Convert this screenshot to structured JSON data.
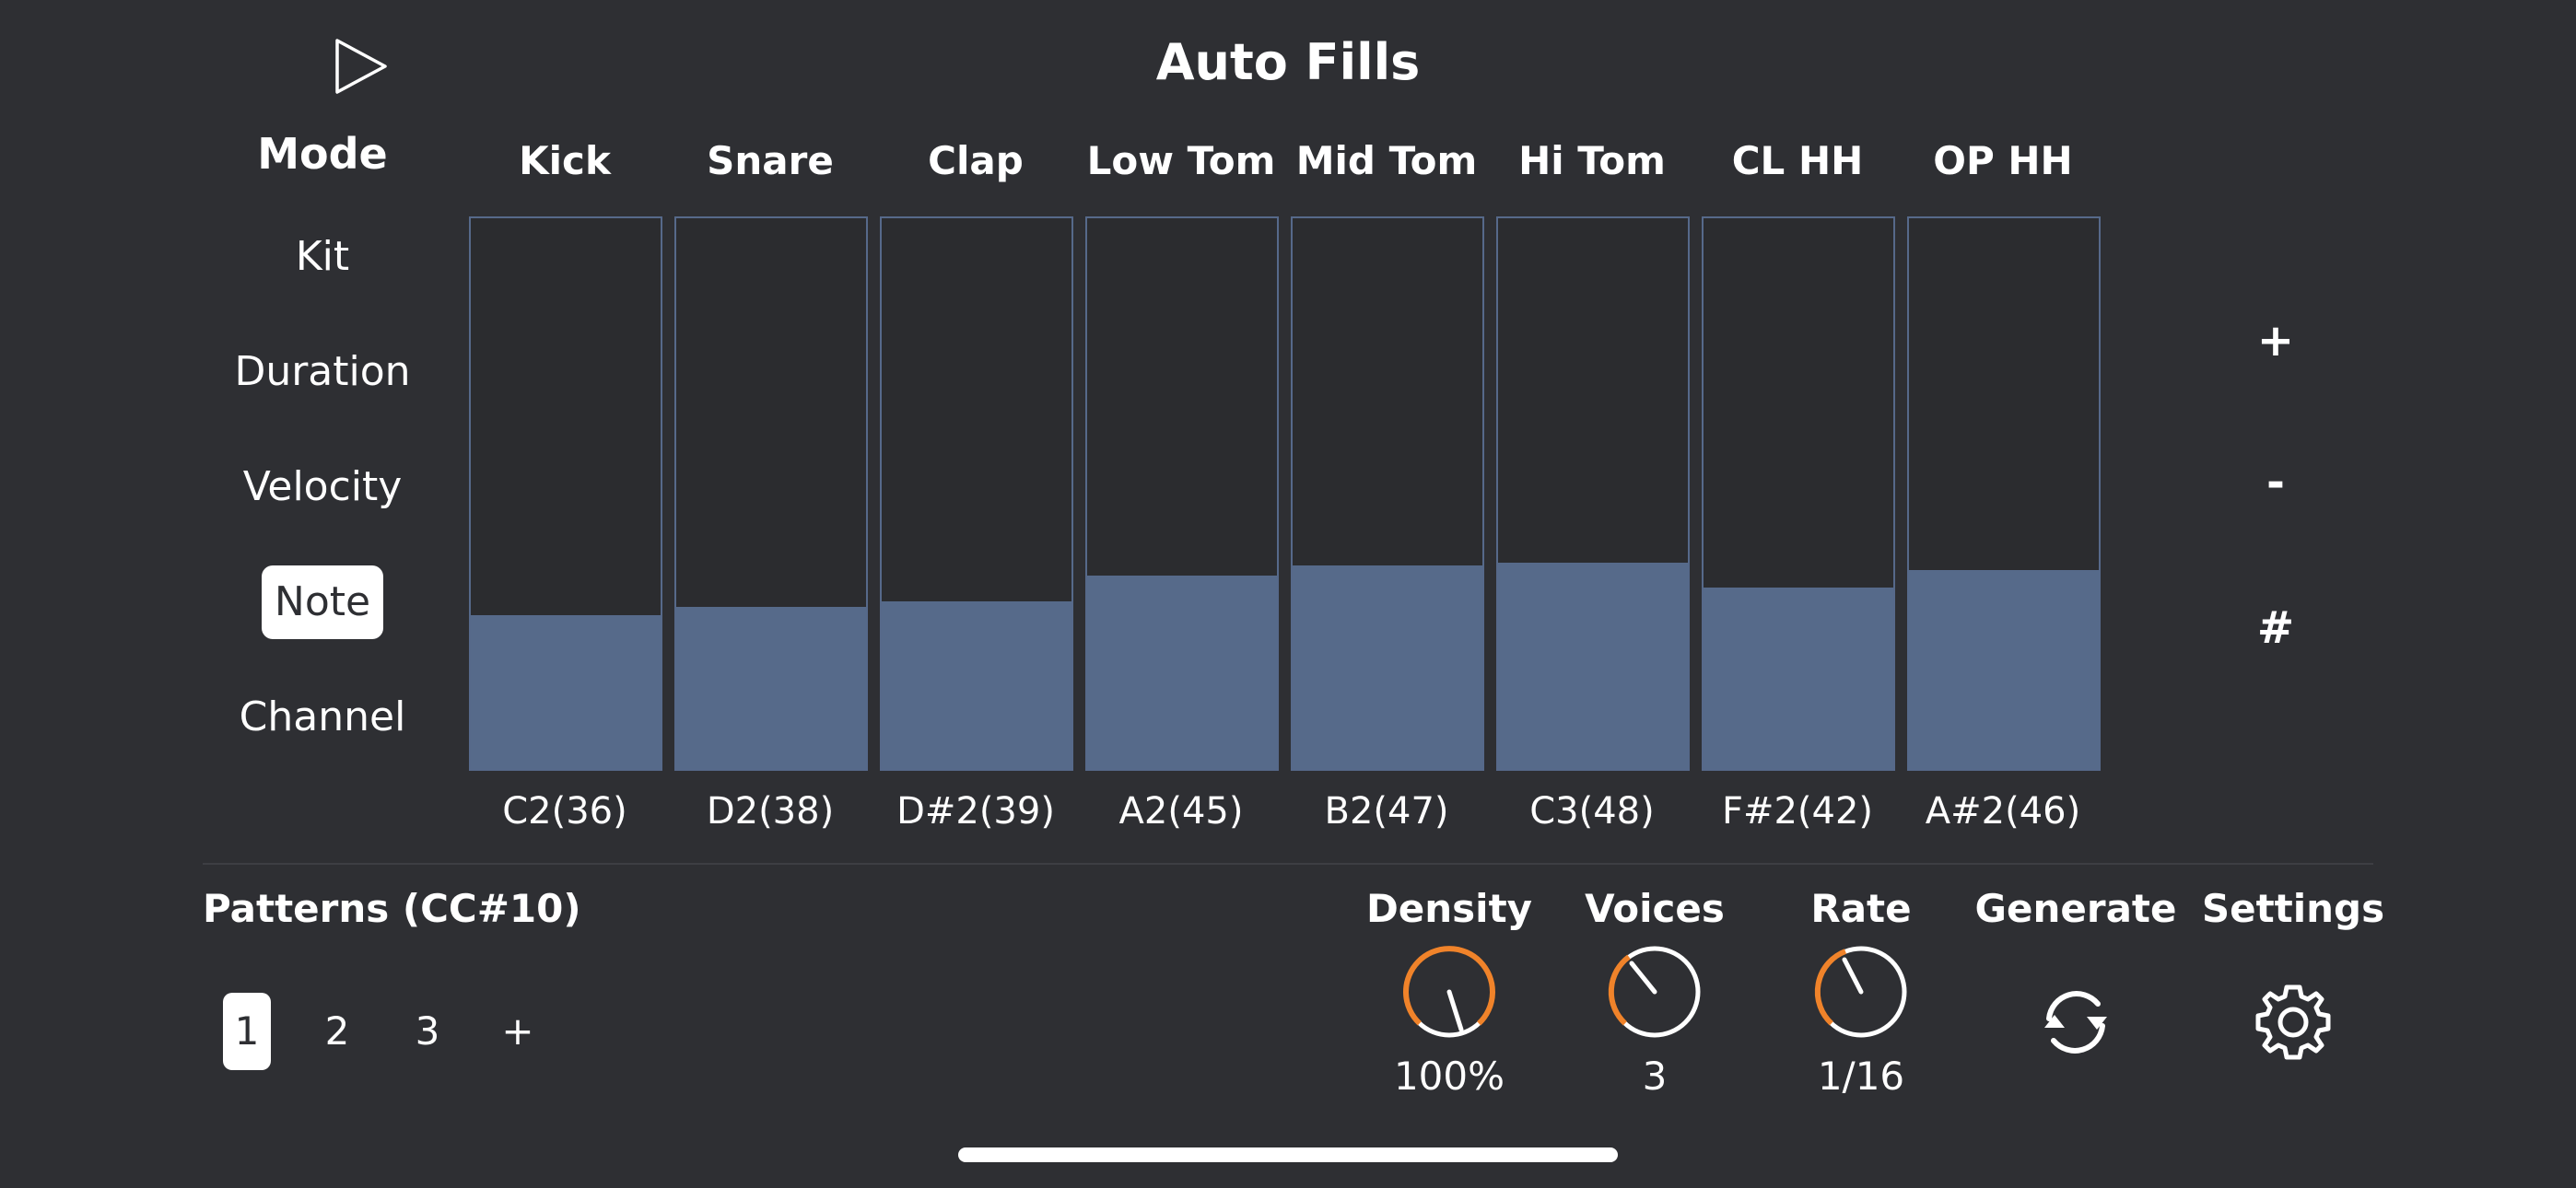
{
  "header": {
    "title": "Auto Fills",
    "play_icon": "play-icon"
  },
  "mode": {
    "title": "Mode",
    "items": [
      {
        "label": "Kit",
        "selected": false
      },
      {
        "label": "Duration",
        "selected": false
      },
      {
        "label": "Velocity",
        "selected": false
      },
      {
        "label": "Note",
        "selected": true
      },
      {
        "label": "Channel",
        "selected": false
      }
    ]
  },
  "tracks": [
    {
      "name": "Kick",
      "note": "C2(36)",
      "level": 0.28
    },
    {
      "name": "Snare",
      "note": "D2(38)",
      "level": 0.295
    },
    {
      "name": "Clap",
      "note": "D#2(39)",
      "level": 0.305
    },
    {
      "name": "Low Tom",
      "note": "A2(45)",
      "level": 0.352
    },
    {
      "name": "Mid Tom",
      "note": "B2(47)",
      "level": 0.37
    },
    {
      "name": "Hi Tom",
      "note": "C3(48)",
      "level": 0.375
    },
    {
      "name": "CL HH",
      "note": "F#2(42)",
      "level": 0.33
    },
    {
      "name": "OP HH",
      "note": "A#2(46)",
      "level": 0.362
    }
  ],
  "side_buttons": {
    "plus": "+",
    "minus": "-",
    "sharp": "#"
  },
  "patterns": {
    "title": "Patterns (CC#10)",
    "items": [
      "1",
      "2",
      "3",
      "+"
    ],
    "selected_index": 0
  },
  "controls": {
    "density": {
      "label": "Density",
      "value": "100%"
    },
    "voices": {
      "label": "Voices",
      "value": "3"
    },
    "rate": {
      "label": "Rate",
      "value": "1/16"
    },
    "generate": {
      "label": "Generate",
      "icon": "refresh-icon"
    },
    "settings": {
      "label": "Settings",
      "icon": "gear-icon"
    }
  },
  "colors": {
    "background": "#2e2f33",
    "slider_fill": "#566a8a",
    "slider_border": "#56698a",
    "knob_accent": "#f0832a",
    "text": "#ffffff"
  }
}
